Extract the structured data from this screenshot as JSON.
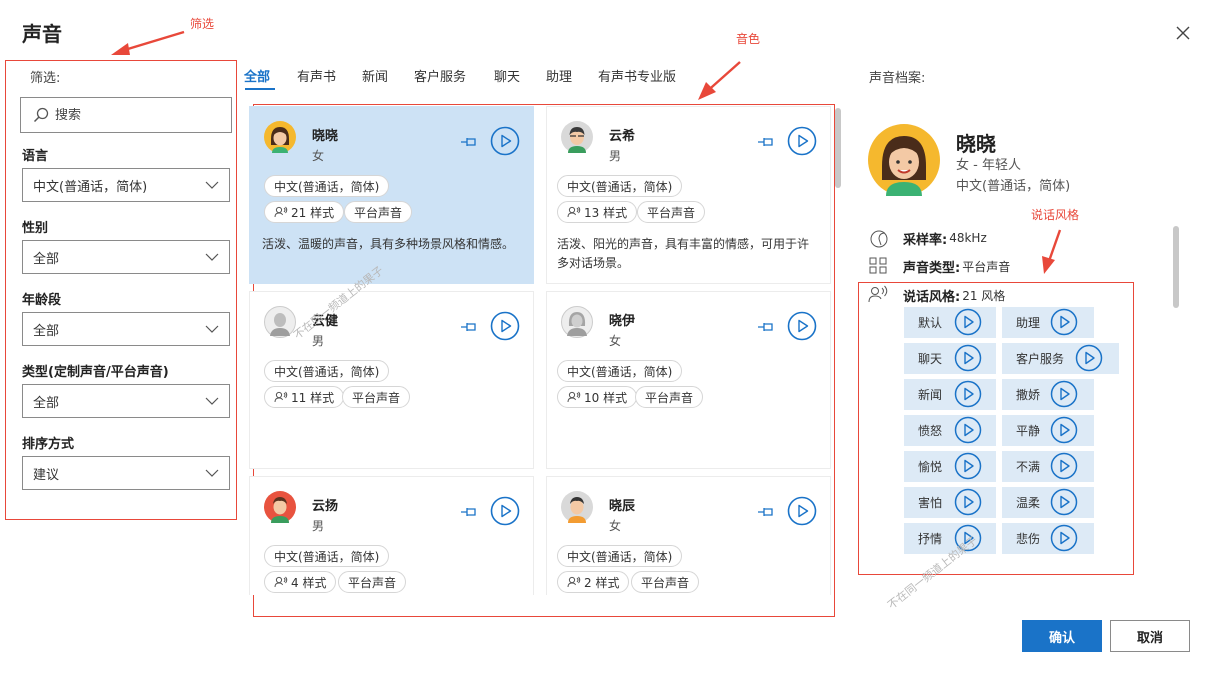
{
  "dialog": {
    "title": "声音"
  },
  "annotations": {
    "filter": "筛选",
    "voices": "音色",
    "styles": "说话风格"
  },
  "filter": {
    "heading": "筛选:",
    "search_placeholder": "搜索",
    "fields": [
      {
        "label": "语言",
        "value": "中文(普通话，简体)"
      },
      {
        "label": "性别",
        "value": "全部"
      },
      {
        "label": "年龄段",
        "value": "全部"
      },
      {
        "label": "类型(定制声音/平台声音)",
        "value": "全部"
      },
      {
        "label": "排序方式",
        "value": "建议"
      }
    ]
  },
  "tabs": [
    {
      "label": "全部",
      "active": true
    },
    {
      "label": "有声书"
    },
    {
      "label": "新闻"
    },
    {
      "label": "客户服务"
    },
    {
      "label": "聊天"
    },
    {
      "label": "助理"
    },
    {
      "label": "有声书专业版"
    }
  ],
  "voices": [
    {
      "name": "晓晓",
      "gender": "女",
      "language": "中文(普通话，简体)",
      "styles": "21 样式",
      "type": "平台声音",
      "description": "活泼、温暖的声音，具有多种场景风格和情感。",
      "selected": true
    },
    {
      "name": "云希",
      "gender": "男",
      "language": "中文(普通话，简体)",
      "styles": "13 样式",
      "type": "平台声音",
      "description": "活泼、阳光的声音，具有丰富的情感，可用于许多对话场景。"
    },
    {
      "name": "云健",
      "gender": "男",
      "language": "中文(普通话，简体)",
      "styles": "11 样式",
      "type": "平台声音"
    },
    {
      "name": "晓伊",
      "gender": "女",
      "language": "中文(普通话，简体)",
      "styles": "10 样式",
      "type": "平台声音"
    },
    {
      "name": "云扬",
      "gender": "男",
      "language": "中文(普通话，简体)",
      "styles": "4 样式",
      "type": "平台声音"
    },
    {
      "name": "晓辰",
      "gender": "女",
      "language": "中文(普通话，简体)",
      "styles": "2 样式",
      "type": "平台声音"
    }
  ],
  "profile": {
    "heading": "声音档案:",
    "name": "晓晓",
    "gender_age": "女 - 年轻人",
    "language": "中文(普通话，简体)",
    "sample_rate_label": "采样率:",
    "sample_rate": "48kHz",
    "voice_type_label": "声音类型:",
    "voice_type": "平台声音",
    "speaking_style_label": "说话风格:",
    "speaking_style_count": "21 风格",
    "styles": [
      "默认",
      "助理",
      "聊天",
      "客户服务",
      "新闻",
      "撒娇",
      "愤怒",
      "平静",
      "愉悦",
      "不满",
      "害怕",
      "温柔",
      "抒情",
      "悲伤"
    ]
  },
  "footer": {
    "confirm": "确认",
    "cancel": "取消"
  },
  "watermark": "不在同一频道上的果子",
  "colors": {
    "accent": "#1a73c8",
    "selected_card": "#cde2f5",
    "style_cell": "#ddeaf6",
    "annotation": "#e8483a"
  }
}
